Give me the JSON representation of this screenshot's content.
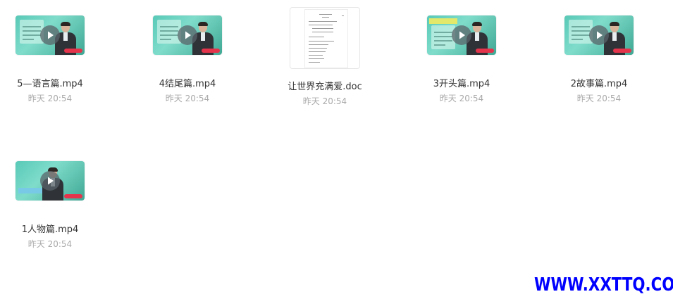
{
  "files": [
    {
      "name": "5—语言篇.mp4",
      "time": "昨天 20:54",
      "kind": "video"
    },
    {
      "name": "4结尾篇.mp4",
      "time": "昨天 20:54",
      "kind": "video"
    },
    {
      "name": "让世界充满爱.doc",
      "time": "昨天 20:54",
      "kind": "doc"
    },
    {
      "name": "3开头篇.mp4",
      "time": "昨天 20:54",
      "kind": "video"
    },
    {
      "name": "2故事篇.mp4",
      "time": "昨天 20:54",
      "kind": "video"
    },
    {
      "name": "1人物篇.mp4",
      "time": "昨天 20:54",
      "kind": "video"
    }
  ],
  "icons": {
    "video": "play-icon",
    "doc": "document-icon"
  },
  "colors": {
    "name_text": "#333333",
    "time_text": "#aaaaaa",
    "thumb_teal": "#59c9b7",
    "watermark": "#0000ff"
  },
  "watermark": {
    "text": "WWW.XXTTQ.COM"
  }
}
